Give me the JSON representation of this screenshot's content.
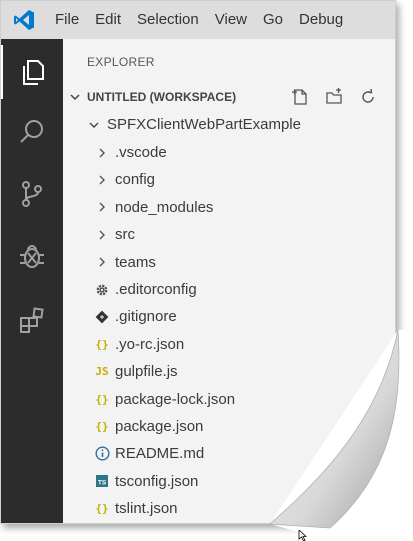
{
  "menu": [
    "File",
    "Edit",
    "Selection",
    "View",
    "Go",
    "Debug"
  ],
  "sidebar": {
    "title": "EXPLORER",
    "workspace": "UNTITLED (WORKSPACE)",
    "project": "SPFXClientWebPartExample"
  },
  "tree": [
    {
      "label": ".vscode",
      "kind": "folder",
      "icon": "chevron-right-icon"
    },
    {
      "label": "config",
      "kind": "folder",
      "icon": "chevron-right-icon"
    },
    {
      "label": "node_modules",
      "kind": "folder",
      "icon": "chevron-right-icon"
    },
    {
      "label": "src",
      "kind": "folder",
      "icon": "chevron-right-icon"
    },
    {
      "label": "teams",
      "kind": "folder",
      "icon": "chevron-right-icon"
    },
    {
      "label": ".editorconfig",
      "kind": "file",
      "icon": "gear-icon"
    },
    {
      "label": ".gitignore",
      "kind": "file",
      "icon": "git-icon"
    },
    {
      "label": ".yo-rc.json",
      "kind": "file",
      "icon": "json-icon"
    },
    {
      "label": "gulpfile.js",
      "kind": "file",
      "icon": "js-icon"
    },
    {
      "label": "package-lock.json",
      "kind": "file",
      "icon": "json-icon"
    },
    {
      "label": "package.json",
      "kind": "file",
      "icon": "json-icon"
    },
    {
      "label": "README.md",
      "kind": "file",
      "icon": "info-icon"
    },
    {
      "label": "tsconfig.json",
      "kind": "file",
      "icon": "ts-icon"
    },
    {
      "label": "tslint.json",
      "kind": "file",
      "icon": "json-icon"
    }
  ],
  "colors": {
    "accent": "#007acc",
    "json": "#c5b000",
    "js": "#c9ab00",
    "ts": "#2b7489",
    "activity_bg": "#2c2c2c"
  }
}
